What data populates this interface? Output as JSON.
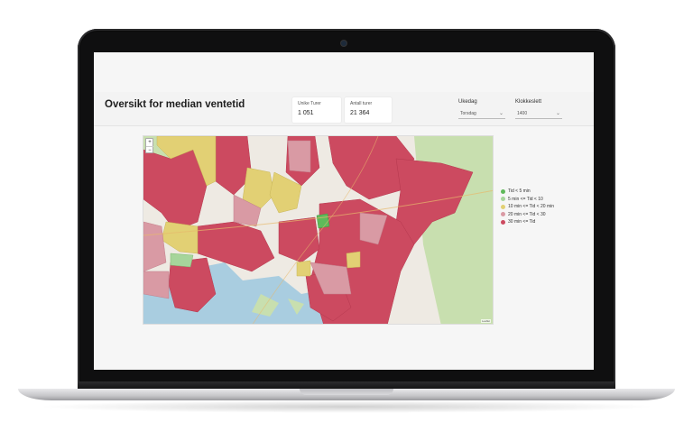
{
  "dashboard": {
    "title": "Oversikt for median ventetid",
    "kpis": [
      {
        "label": "Unike Turer",
        "value": "1 051"
      },
      {
        "label": "Antall turer",
        "value": "21 364"
      }
    ],
    "slicers": [
      {
        "label": "Ukedag",
        "value": "Torsdag"
      },
      {
        "label": "Klokkeslett",
        "value": "1400"
      }
    ]
  },
  "map": {
    "zoom_in": "+",
    "zoom_out": "−",
    "attribution": "Leaflet",
    "colors": {
      "water": "#a9cde0",
      "forest": "#c8dfaf",
      "land": "#eeeae3",
      "lt5": "#5fb95a",
      "5to10": "#a6d59b",
      "10to20": "#e2d074",
      "20to30": "#d99aa4",
      "gt30": "#cc4a60"
    }
  },
  "legend": {
    "items": [
      {
        "label": "Tid < 5 min",
        "color": "#5fb95a"
      },
      {
        "label": "5 min <= Tid < 10",
        "color": "#a6d59b"
      },
      {
        "label": "10 min <= Tid < 20 min",
        "color": "#e2d074"
      },
      {
        "label": "20 min <= Tid < 30",
        "color": "#d99aa4"
      },
      {
        "label": "30 min <= Tid",
        "color": "#cc4a60"
      }
    ]
  }
}
